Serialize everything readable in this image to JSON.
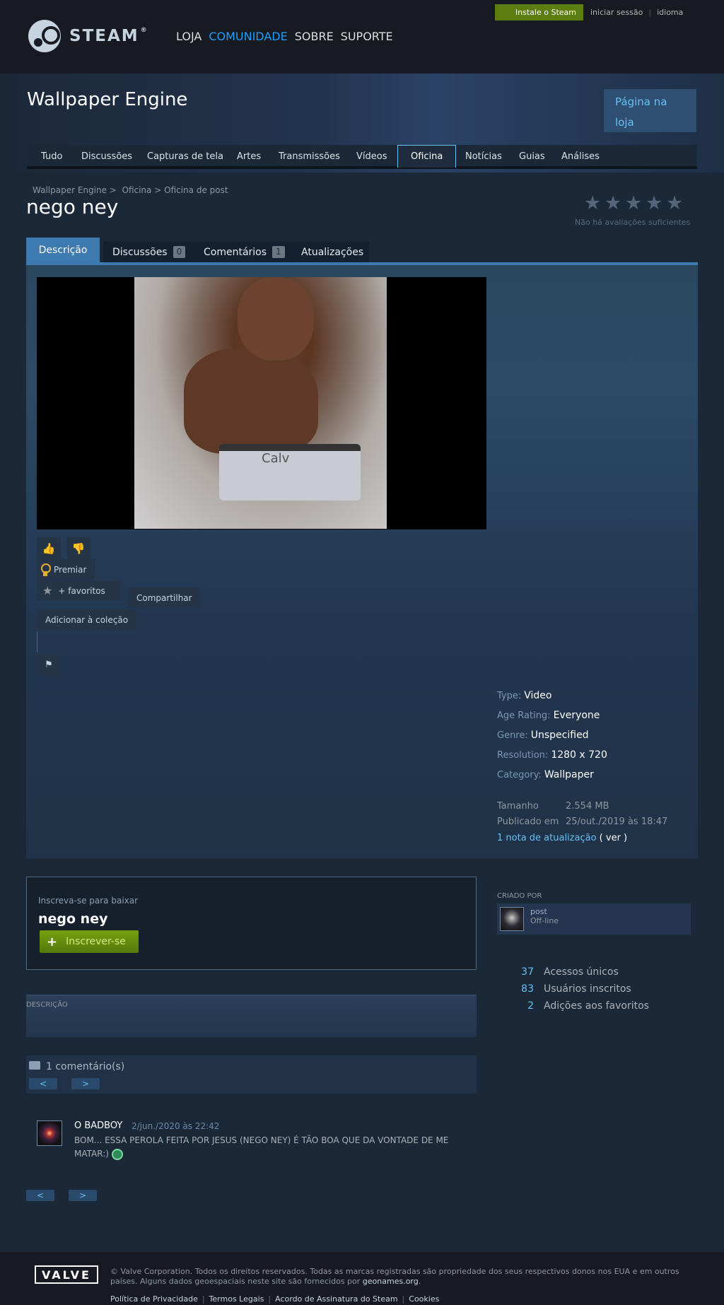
{
  "header": {
    "logo_text": "STEAM",
    "logo_tm": "®",
    "nav": [
      "LOJA",
      "COMUNIDADE",
      "SOBRE",
      "SUPORTE"
    ],
    "nav_active": "COMUNIDADE",
    "install_label": "Instale o Steam",
    "login_label": "iniciar sessão",
    "language_label": "idioma"
  },
  "app": {
    "title": "Wallpaper Engine",
    "store_link": "Página na loja",
    "tabs": [
      "Tudo",
      "Discussões",
      "Capturas de tela",
      "Artes",
      "Transmissões",
      "Vídeos",
      "Oficina",
      "Notícias",
      "Guias",
      "Análises"
    ],
    "active_tab": "Oficina"
  },
  "breadcrumb": {
    "app": "Wallpaper Engine",
    "sep": ">",
    "workshop": "Oficina",
    "user_workshop": "Oficina de post"
  },
  "item": {
    "title": "nego ney",
    "rating_stars": 5,
    "rating_note": "Não há avaliações suficientes"
  },
  "detail_tabs": {
    "description": "Descrição",
    "discussions": "Discussões",
    "discussions_count": "0",
    "comments": "Comentários",
    "comments_count": "1",
    "updates": "Atualizações"
  },
  "video": {
    "overlay_text": "Calv"
  },
  "actions": {
    "award": "Premiar",
    "favorite": "+ favoritos",
    "share": "Compartilhar",
    "add_collection": "Adicionar à coleção"
  },
  "metadata": {
    "type_k": "Type:",
    "type_v": "Video",
    "age_k": "Age Rating:",
    "age_v": "Everyone",
    "genre_k": "Genre:",
    "genre_v": "Unspecified",
    "res_k": "Resolution:",
    "res_v": "1280 x 720",
    "cat_k": "Category:",
    "cat_v": "Wallpaper"
  },
  "stats": {
    "size_k": "Tamanho",
    "size_v": "2.554 MB",
    "posted_k": "Publicado em",
    "posted_v": "25/out./2019 às 18:47",
    "notes_link": "1 nota de atualização",
    "notes_view": "( ver )"
  },
  "subscribe": {
    "hint": "Inscreva-se para baixar",
    "title": "nego ney",
    "button": "Inscrever-se"
  },
  "creator": {
    "label": "CRIADO POR",
    "name": "post",
    "status": "Off-line"
  },
  "community_stats": [
    {
      "value": "37",
      "label": "Acessos únicos"
    },
    {
      "value": "83",
      "label": "Usuários inscritos"
    },
    {
      "value": "2",
      "label": "Adições aos favoritos"
    }
  ],
  "description_label": "DESCRIÇÃO",
  "comments": {
    "count_label": "1 comentário(s)",
    "prev": "<",
    "next": ">",
    "items": [
      {
        "author": "O BADBOY",
        "date": "2/jun./2020 às 22:42",
        "text": "BOM... ESSA PEROLA FEITA POR JESUS (NEGO NEY) É TÃO BOA QUE DA VONTADE DE ME MATAR:)"
      }
    ]
  },
  "footer": {
    "valve": "VALVE",
    "copyright": "© Valve Corporation. Todos os direitos reservados. Todas as marcas registradas são propriedade dos seus respectivos donos nos EUA e em outros países. Alguns dados geoespaciais neste site são fornecidos por",
    "geonames": "geonames.org",
    "links": [
      "Política de Privacidade",
      "Termos Legais",
      "Acordo de Assinatura do Steam",
      "Cookies"
    ]
  },
  "colors": {
    "accent": "#67c1f5",
    "nav_active": "#1a9fff",
    "install_green": "#5c7e10",
    "background": "#1b2838"
  }
}
